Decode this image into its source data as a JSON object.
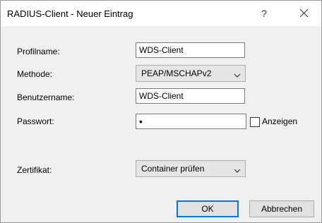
{
  "window": {
    "title": "RADIUS-Client - Neuer Eintrag",
    "help_glyph": "?"
  },
  "form": {
    "profile": {
      "label": "Profilname:",
      "value": "WDS-Client"
    },
    "method": {
      "label": "Methode:",
      "value": "PEAP/MSCHAPv2"
    },
    "username": {
      "label": "Benutzername:",
      "value": "WDS-Client"
    },
    "password": {
      "label": "Passwort:",
      "value": "•",
      "show_label": "Anzeigen",
      "show_checked": false
    },
    "certificate": {
      "label": "Zertifikat:",
      "value": "Container prüfen"
    }
  },
  "buttons": {
    "ok": "OK",
    "cancel": "Abbrechen"
  },
  "icons": {
    "close": "close-icon",
    "help": "help-icon",
    "dropdown": "chevron-down-icon"
  },
  "colors": {
    "window_bg": "#f0f0f0",
    "titlebar_bg": "#ffffff",
    "default_button_border": "#0078d7"
  }
}
